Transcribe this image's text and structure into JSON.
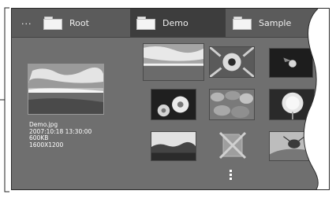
{
  "tabs": [
    {
      "label": "Root",
      "active": false
    },
    {
      "label": "Demo",
      "active": true
    },
    {
      "label": "Sample",
      "active": false
    }
  ],
  "overflow_label": "...",
  "preview": {
    "filename": "Demo.jpg",
    "datetime": "2007:10:18 13:30:00",
    "size": "600KB",
    "resolution": "1600X1200"
  },
  "thumbnails": [
    {
      "name": "landscape-sky"
    },
    {
      "name": "flower-blossom"
    },
    {
      "name": "bird-silhouette"
    },
    {
      "name": "daisies"
    },
    {
      "name": "stones"
    },
    {
      "name": "dandelion"
    },
    {
      "name": "trees-horizon"
    },
    {
      "name": "unavailable"
    },
    {
      "name": "insect-leaf"
    }
  ]
}
